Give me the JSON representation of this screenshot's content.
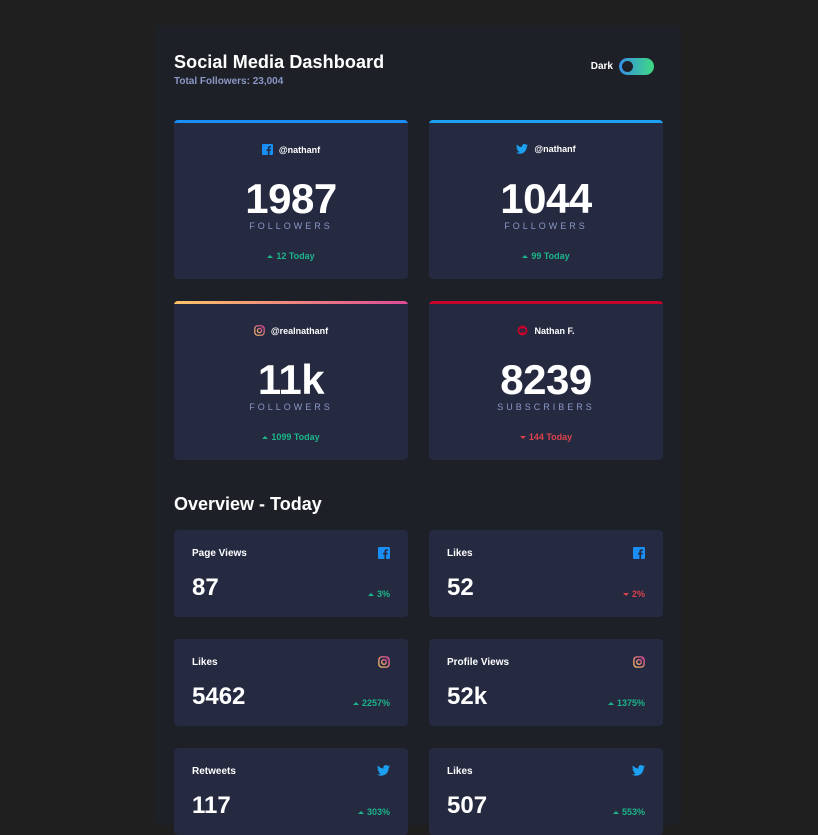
{
  "header": {
    "title": "Social Media Dashboard",
    "total_followers": "Total Followers: 23,004",
    "toggle_label": "Dark",
    "toggle_on": true
  },
  "colors": {
    "facebook": "#198ff5",
    "twitter": "#1ca0f2",
    "instagram_gradient": [
      "#fdc468",
      "#df4996"
    ],
    "youtube": "#c4032b",
    "up": "#1db489",
    "down": "#dc414c",
    "card_bg": "#252a41",
    "page_bg": "#1e2027"
  },
  "cards": [
    {
      "platform": "facebook",
      "icon": "facebook-icon",
      "handle": "@nathanf",
      "count": "1987",
      "unit": "FOLLOWERS",
      "change": "12 Today",
      "trend": "up"
    },
    {
      "platform": "twitter",
      "icon": "twitter-icon",
      "handle": "@nathanf",
      "count": "1044",
      "unit": "FOLLOWERS",
      "change": "99 Today",
      "trend": "up"
    },
    {
      "platform": "instagram",
      "icon": "instagram-icon",
      "handle": "@realnathanf",
      "count": "11k",
      "unit": "FOLLOWERS",
      "change": "1099 Today",
      "trend": "up"
    },
    {
      "platform": "youtube",
      "icon": "youtube-icon",
      "handle": "Nathan F.",
      "count": "8239",
      "unit": "SUBSCRIBERS",
      "change": "144 Today",
      "trend": "down"
    }
  ],
  "overview": {
    "title": "Overview - Today",
    "items": [
      {
        "label": "Page Views",
        "platform": "facebook",
        "icon": "facebook-icon",
        "value": "87",
        "change": "3%",
        "trend": "up"
      },
      {
        "label": "Likes",
        "platform": "facebook",
        "icon": "facebook-icon",
        "value": "52",
        "change": "2%",
        "trend": "down"
      },
      {
        "label": "Likes",
        "platform": "instagram",
        "icon": "instagram-icon",
        "value": "5462",
        "change": "2257%",
        "trend": "up"
      },
      {
        "label": "Profile Views",
        "platform": "instagram",
        "icon": "instagram-icon",
        "value": "52k",
        "change": "1375%",
        "trend": "up"
      },
      {
        "label": "Retweets",
        "platform": "twitter",
        "icon": "twitter-icon",
        "value": "117",
        "change": "303%",
        "trend": "up"
      },
      {
        "label": "Likes",
        "platform": "twitter",
        "icon": "twitter-icon",
        "value": "507",
        "change": "553%",
        "trend": "up"
      }
    ]
  }
}
